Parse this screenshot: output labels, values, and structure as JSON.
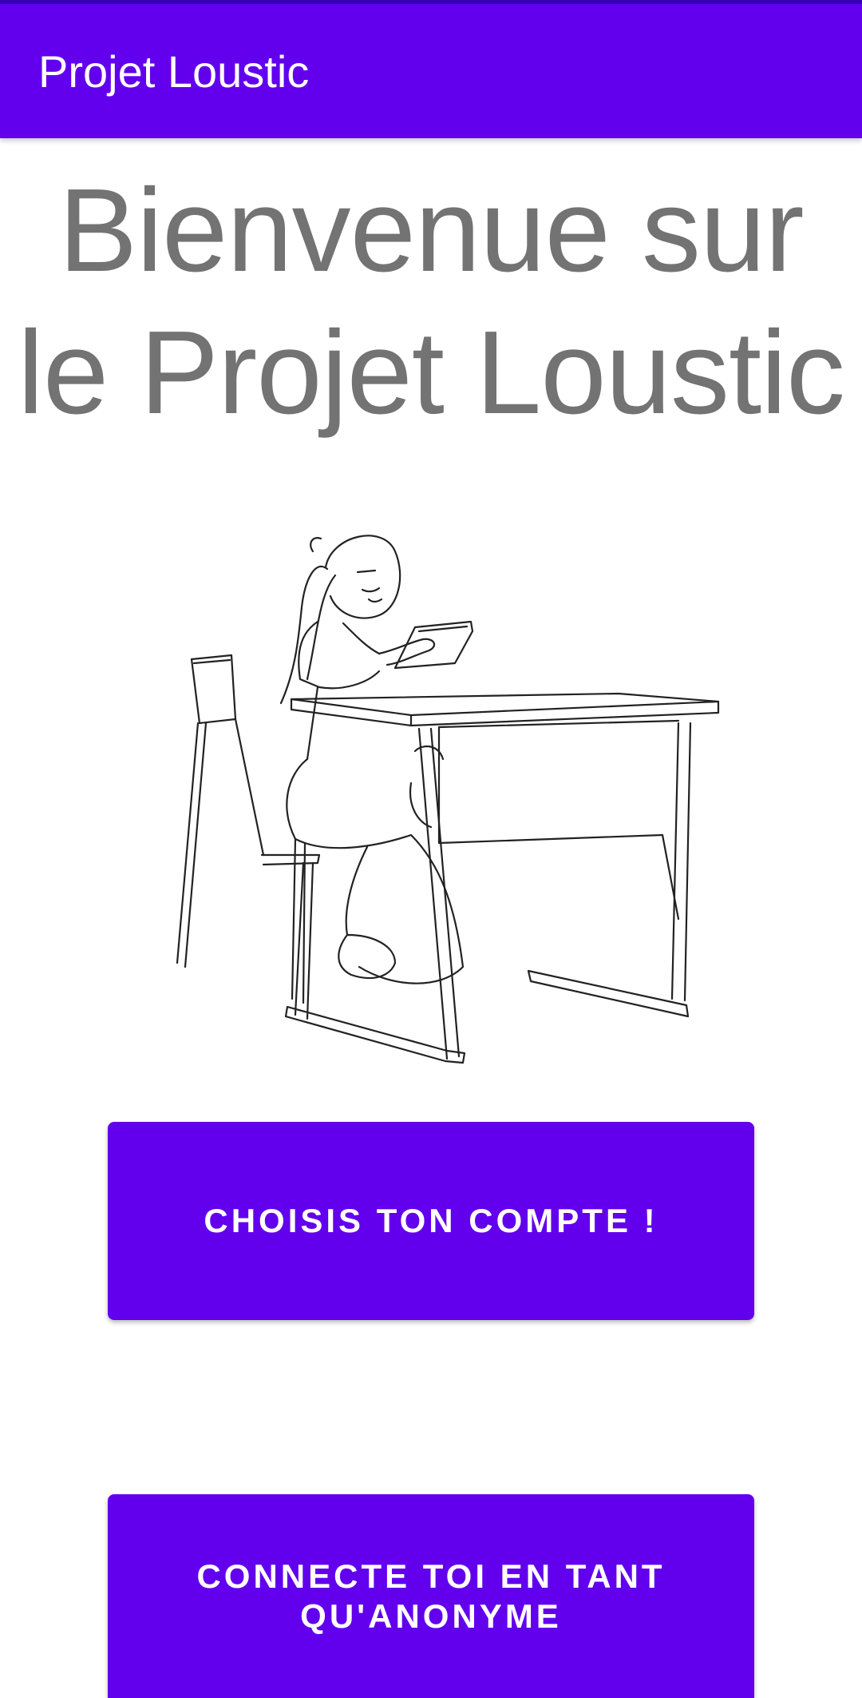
{
  "app_bar": {
    "title": "Projet Loustic"
  },
  "welcome": {
    "line1": "Bienvenue sur",
    "line2": "le Projet Loustic"
  },
  "illustration": {
    "icon": "child-at-desk-with-tablet-sketch"
  },
  "buttons": {
    "choose_account": "CHOISIS TON COMPTE !",
    "anonymous_line1": "CONNECTE TOI EN TANT",
    "anonymous_line2": "QU'ANONYME"
  },
  "colors": {
    "primary": "#6200ee",
    "primary_dark": "#3700b3",
    "welcome_text": "#737373"
  }
}
